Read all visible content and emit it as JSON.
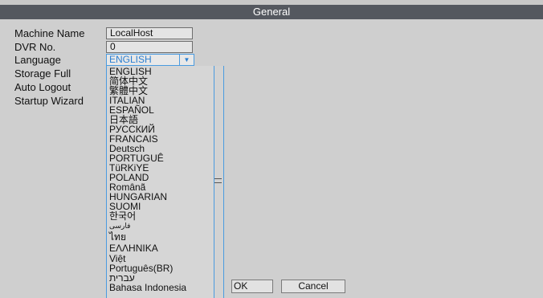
{
  "window": {
    "title": "General"
  },
  "labels": {
    "machine_name": "Machine Name",
    "dvr_no": "DVR No.",
    "language": "Language",
    "storage_full": "Storage Full",
    "auto_logout": "Auto Logout",
    "startup_wizard": "Startup Wizard"
  },
  "fields": {
    "machine_name_value": "LocalHost",
    "dvr_no_value": "0",
    "language_selected": "ENGLISH"
  },
  "language_options": [
    "ENGLISH",
    "简体中文",
    "繁體中文",
    "ITALIAN",
    "ESPAÑOL",
    "日本語",
    "РУССКИЙ",
    "FRANCAIS",
    "Deutsch",
    "PORTUGUÊ",
    "TüRKiYE",
    "POLAND",
    "Românã",
    "HUNGARIAN",
    "SUOMI",
    "한국어",
    "فارسی",
    "ไทย",
    "ΕΛΛΗΝΙΚΑ",
    "Việt",
    "Português(BR)",
    "עברית",
    "Bahasa Indonesia"
  ],
  "buttons": {
    "ok": "OK",
    "cancel": "Cancel"
  },
  "colors": {
    "title_bar": "#54585f",
    "accent": "#4a9be0",
    "background": "#cfcfcf"
  }
}
